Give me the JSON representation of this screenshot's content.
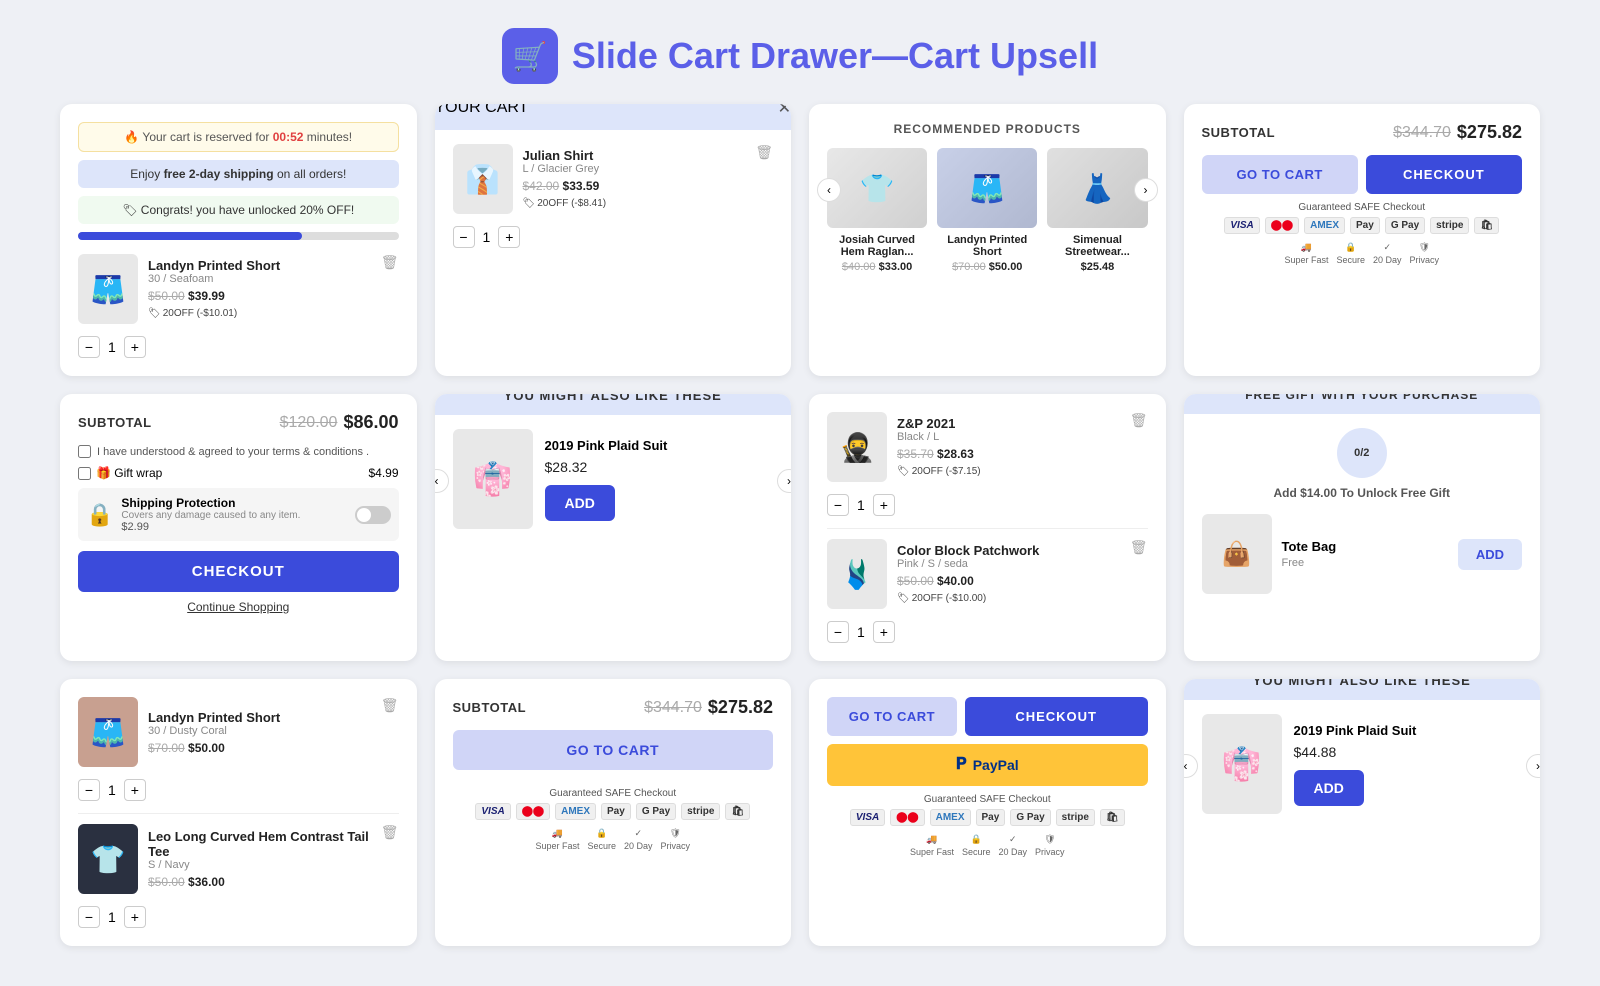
{
  "header": {
    "icon": "🛒",
    "title_static": "Slide Cart Drawer",
    "title_dash": "—",
    "title_accent": "Cart Upsell"
  },
  "card1": {
    "timer_text": "🔥 Your cart is reserved for",
    "timer_value": "00:52",
    "timer_suffix": "minutes!",
    "shipping_prefix": "Enjoy",
    "shipping_bold": "free 2-day shipping",
    "shipping_suffix": "on all orders!",
    "unlock_text": "🏷 Congrats! you have unlocked 20% OFF!",
    "product_name": "Landyn Printed Short",
    "product_variant": "30 / Seafoam",
    "product_original_price": "$50.00",
    "product_price": "$39.99",
    "product_discount": "20OFF (-$10.01)",
    "qty": "1",
    "progress": 70
  },
  "card2": {
    "header": "YOUR CART",
    "product_name": "Julian Shirt",
    "product_variant": "L / Glacier Grey",
    "product_original_price": "$42.00",
    "product_price": "$33.59",
    "product_discount": "20OFF (-$8.41)",
    "qty": "1"
  },
  "card3": {
    "header": "RECOMMENDED PRODUCTS",
    "products": [
      {
        "name": "Josiah Curved Hem Raglan...",
        "original": "$40.00",
        "price": "$33.00"
      },
      {
        "name": "Landyn Printed Short",
        "original": "$70.00",
        "price": "$50.00"
      },
      {
        "name": "Simenual Streetwear...",
        "price": "$25.48"
      }
    ]
  },
  "card4": {
    "subtotal_label": "SUBTOTAL",
    "subtotal_original": "$344.70",
    "subtotal_price": "$275.82",
    "go_to_cart": "GO TO CART",
    "checkout": "CHECKOUT",
    "safe_checkout": "Guaranteed SAFE Checkout",
    "payment_methods": [
      "VISA",
      "MC",
      "AMEX",
      "Apple Pay",
      "G Pay",
      "stripe",
      "shopify"
    ],
    "trust_items": [
      "Super Fast Delivery",
      "Secure Checkout",
      "20 Day Stress-Free Guarantee",
      "Privacy Protected"
    ]
  },
  "card5": {
    "subtotal_label": "SUBTOTAL",
    "subtotal_original": "$120.00",
    "subtotal_price": "$86.00",
    "terms_label": "I have understood & agreed to your terms & conditions .",
    "gift_wrap_label": "🎁 Gift wrap",
    "gift_wrap_price": "$4.99",
    "shipping_prot_label": "Shipping Protection",
    "shipping_prot_sub": "Covers any damage caused to any item.",
    "shipping_prot_price": "$2.99",
    "checkout": "CHECKOUT",
    "continue_shopping": "Continue Shopping"
  },
  "card6": {
    "header": "YOU MIGHT ALSO LIKE THESE",
    "product_name": "2019 Pink Plaid Suit",
    "product_price": "$28.32",
    "add_label": "ADD"
  },
  "card7": {
    "products": [
      {
        "name": "Z&P 2021",
        "variant": "Black / L",
        "original": "$35.70",
        "price": "$28.63",
        "discount": "20OFF (-$7.15)",
        "qty": "1"
      },
      {
        "name": "Color Block Patchwork",
        "variant": "Pink / S / seda",
        "original": "$50.00",
        "price": "$40.00",
        "discount": "20OFF (-$10.00)",
        "qty": "1"
      }
    ]
  },
  "card8": {
    "header": "FREE GIFT WITH YOUR PURCHASE",
    "circle_label": "0/2",
    "unlock_text": "Add $14.00 To Unlock Free Gift",
    "gift_name": "Tote Bag",
    "gift_price": "Free",
    "add_label": "ADD"
  },
  "card9": {
    "products": [
      {
        "name": "Landyn Printed Short",
        "variant": "30 / Dusty Coral",
        "original": "$70.00",
        "price": "$50.00",
        "qty": "1"
      },
      {
        "name": "Leo Long Curved Hem Contrast Tail Tee",
        "variant": "S / Navy",
        "original": "$50.00",
        "price": "$36.00",
        "qty": "1"
      }
    ]
  },
  "card10": {
    "subtotal_label": "SUBTOTAL",
    "subtotal_original": "$344.70",
    "subtotal_price": "$275.82",
    "go_to_cart": "GO TO CART",
    "safe_checkout": "Guaranteed SAFE Checkout",
    "payment_methods": [
      "VISA",
      "MC",
      "AMEX",
      "Apple Pay",
      "G Pay",
      "stripe",
      "shopify"
    ],
    "trust_items": [
      "Super Fast Delivery",
      "Secure Checkout",
      "20 Day Stress-Free Guarantee",
      "Privacy Protected"
    ]
  },
  "card11": {
    "go_to_cart": "GO TO CART",
    "checkout": "CHECKOUT",
    "paypal_label": "PayPal",
    "safe_checkout": "Guaranteed SAFE Checkout",
    "payment_methods": [
      "VISA",
      "MC",
      "AMEX",
      "Apple Pay",
      "G Pay",
      "stripe",
      "shopify"
    ],
    "trust_items": [
      "Super Fast Delivery",
      "Secure Checkout",
      "20 Day Stress-Free Guarantee",
      "Privacy Protected"
    ]
  },
  "card12": {
    "header": "YOU MIGHT ALSO LIKE THESE",
    "product_name": "2019 Pink Plaid Suit",
    "product_price": "$44.88",
    "add_label": "ADD"
  }
}
